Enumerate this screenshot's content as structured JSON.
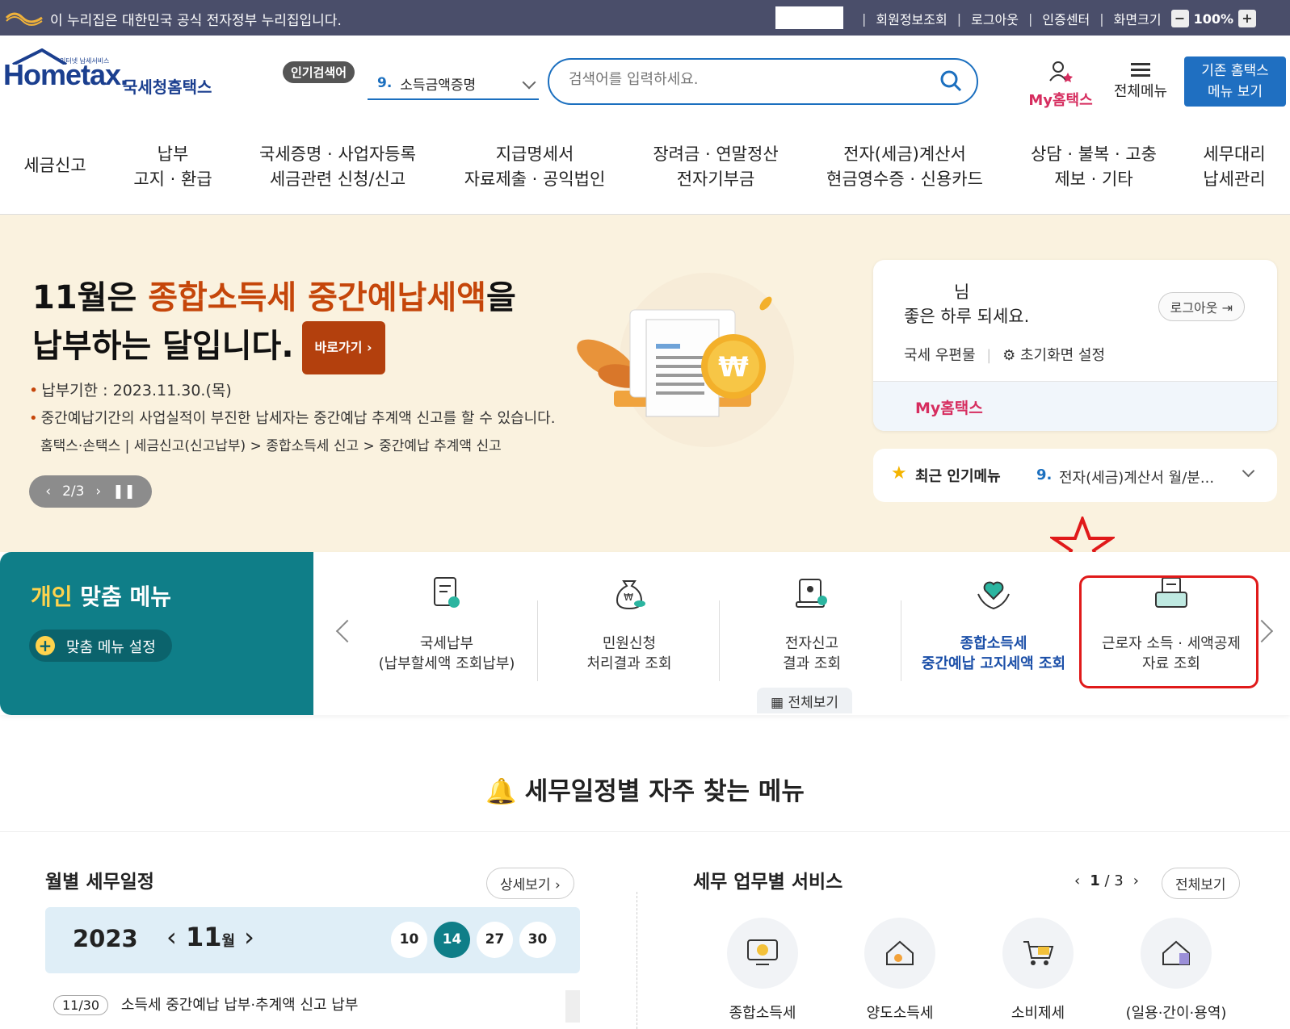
{
  "gov_bar": {
    "notice": "이 누리집은 대한민국 공식 전자정부 누리집입니다.",
    "links": [
      "회원정보조회",
      "로그아웃",
      "인증센터",
      "화면크기"
    ],
    "zoom_minus": "−",
    "zoom_value": "100%",
    "zoom_plus": "+"
  },
  "header": {
    "brand_small": "인터넷 납세서비스",
    "brand_en": "Hometax.",
    "brand_kr": "국세청홈택스",
    "popular_badge": "인기검색어",
    "popular_num": "9.",
    "popular_term": "소득금액증명",
    "search_placeholder": "검색어를 입력하세요.",
    "my_hometax": "My홈택스",
    "all_menu": "전체메뉴",
    "old_menu_line1": "기존 홈택스",
    "old_menu_line2": "메뉴 보기"
  },
  "gnb": [
    {
      "l1": "세금신고",
      "l2": ""
    },
    {
      "l1": "납부",
      "l2": "고지 · 환급"
    },
    {
      "l1": "국세증명 · 사업자등록",
      "l2": "세금관련 신청/신고"
    },
    {
      "l1": "지급명세서",
      "l2": "자료제출 · 공익법인"
    },
    {
      "l1": "장려금 · 연말정산",
      "l2": "전자기부금"
    },
    {
      "l1": "전자(세금)계산서",
      "l2": "현금영수증 · 신용카드"
    },
    {
      "l1": "상담 · 불복 · 고충",
      "l2": "제보 · 기타"
    },
    {
      "l1": "세무대리",
      "l2": "납세관리"
    }
  ],
  "banner": {
    "line1_a": "11월은 ",
    "line1_hl": "종합소득세 중간예납세액",
    "line1_b": "을",
    "line2": "납부하는 달입니다.",
    "go_btn": "바로가기 ›",
    "deadline": "납부기한 : 2023.11.30.(목)",
    "desc": "중간예납기간의 사업실적이 부진한 납세자는 중간예납 추계액 신고를 할 수 있습니다.",
    "path": "홈택스·손택스 | 세금신고(신고납부) > 종합소득세 신고 > 중간예납 추계액 신고",
    "pager": "2/3"
  },
  "user_card": {
    "name_suffix": "님",
    "greeting": "좋은 하루 되세요.",
    "logout": "로그아웃",
    "mail": "국세 우편물",
    "home_setting": "초기화면 설정",
    "my_hometax": "My홈택스"
  },
  "recent": {
    "title": "최근 인기메뉴",
    "num": "9.",
    "value": "전자(세금)계산서 월/분..."
  },
  "custom_menu": {
    "title_a": "개인",
    "title_b": " 맞춤 메뉴",
    "setting": "맞춤 메뉴 설정",
    "items": [
      {
        "l1": "국세납부",
        "l2": "(납부할세액 조회납부)"
      },
      {
        "l1": "민원신청",
        "l2": "처리결과 조회"
      },
      {
        "l1": "전자신고",
        "l2": "결과 조회"
      },
      {
        "l1": "종합소득세",
        "l2": "중간예납 고지세액 조회"
      },
      {
        "l1": "근로자 소득 · 세액공제",
        "l2": "자료 조회"
      }
    ],
    "see_all": "전체보기"
  },
  "schedule": {
    "title": "세무일정별 자주 찾는 메뉴",
    "monthly_title": "월별 세무일정",
    "detail": "상세보기",
    "year": "2023",
    "month": "11",
    "month_unit": "월",
    "days": [
      "10",
      "14",
      "27",
      "30"
    ],
    "selected_day": "14",
    "row_date": "11/30",
    "row_text": "소득세 중간예납 납부·추계액 신고 납부"
  },
  "services": {
    "title": "세무 업무별 서비스",
    "page": "1",
    "total": "/ 3",
    "see_all": "전체보기",
    "items": [
      "종합소득세",
      "양도소득세",
      "소비제세",
      "(일용·간이·용역)"
    ]
  },
  "colors": {
    "gov_bar": "#4a4e6a",
    "brand_blue": "#1b3f8f",
    "accent_blue": "#1f6fc1",
    "teal": "#0f7e88",
    "banner_bg": "#faf2df",
    "banner_highlight": "#c5460a",
    "my_pink": "#d62d5f",
    "annotation_red": "#e01a1a"
  }
}
